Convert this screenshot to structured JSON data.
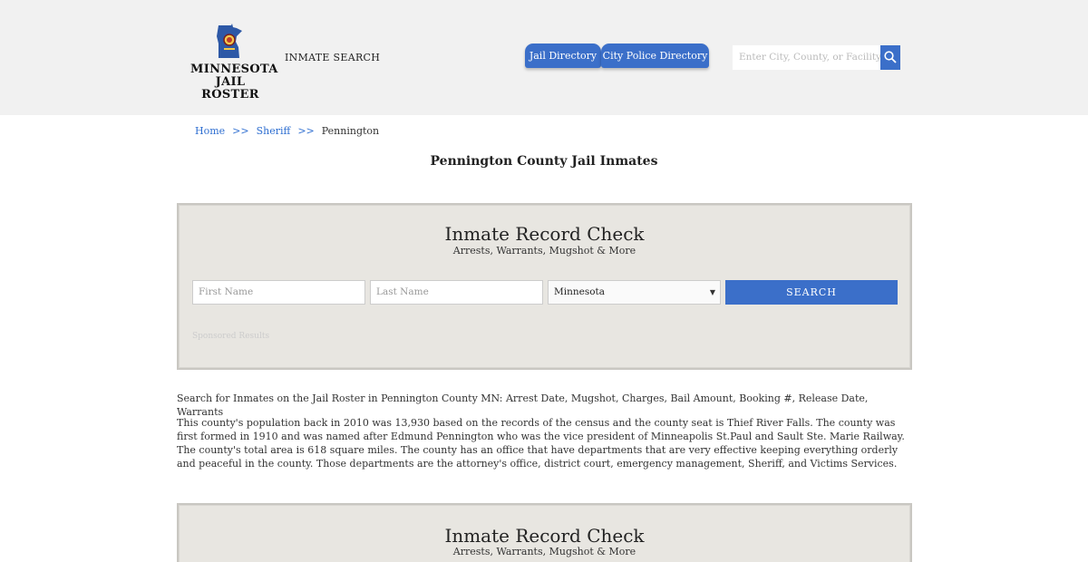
{
  "header": {
    "logo_line1": "MINNESOTA",
    "logo_line2": "JAIL ROSTER",
    "nav_inmate_search": "INMATE SEARCH",
    "jail_directory": "Jail Directory",
    "city_police_directory": "City Police Directory",
    "search_placeholder": "Enter City, County, or Facility"
  },
  "breadcrumb": {
    "home": "Home",
    "sep": ">>",
    "sheriff": "Sheriff",
    "current": "Pennington"
  },
  "page_title": "Pennington County Jail Inmates",
  "record_check": {
    "title": "Inmate Record Check",
    "subtitle": "Arrests, Warrants, Mugshot & More",
    "first_name_placeholder": "First Name",
    "last_name_placeholder": "Last Name",
    "state_selected": "Minnesota",
    "search_label": "SEARCH",
    "sponsored": "Sponsored Results"
  },
  "paragraphs": {
    "p1": "Search for Inmates on the Jail Roster in Pennington County MN: Arrest Date, Mugshot, Charges, Bail Amount, Booking #, Release Date, Warrants",
    "p2": "This county's population back in 2010 was 13,930 based on the records of the census and the county seat is Thief River Falls. The county was first formed in 1910 and was named after Edmund Pennington who was the vice president of Minneapolis St.Paul and Sault Ste. Marie Railway. The county's total area is 618 square miles. The county has an office that have departments that are very effective keeping everything orderly and peaceful in the county. Those departments are the attorney's office, district court, emergency management, Sheriff, and Victims Services."
  },
  "colors": {
    "accent": "#3b6fc9",
    "header_bg": "#f1f1f1",
    "panel_bg": "#e8e6e1",
    "link": "#2f6fd1"
  },
  "icons": {
    "search": "magnifier-icon",
    "logo": "minnesota-state-icon",
    "select_caret": "chevron-down-icon"
  }
}
